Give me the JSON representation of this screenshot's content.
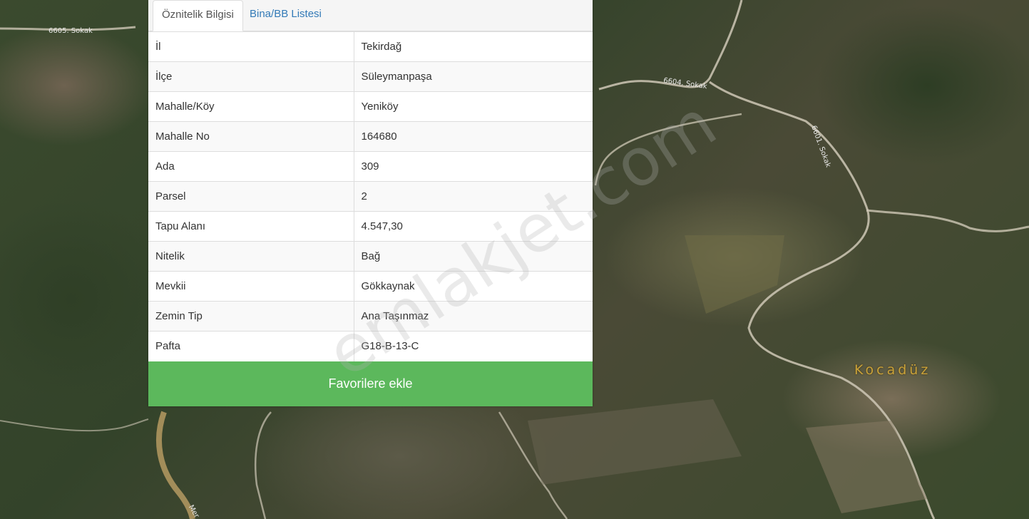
{
  "map": {
    "place_label": "Kocadüz",
    "road_labels": [
      "6605. Sokak",
      "6604. Sokak",
      "6601. Sokak",
      "Mer"
    ]
  },
  "panel": {
    "tabs": [
      {
        "label": "Öznitelik Bilgisi",
        "active": true
      },
      {
        "label": "Bina/BB Listesi",
        "active": false
      }
    ],
    "rows": [
      {
        "key": "İl",
        "value": "Tekirdağ"
      },
      {
        "key": "İlçe",
        "value": "Süleymanpaşa"
      },
      {
        "key": "Mahalle/Köy",
        "value": "Yeniköy"
      },
      {
        "key": "Mahalle No",
        "value": "164680"
      },
      {
        "key": "Ada",
        "value": "309"
      },
      {
        "key": "Parsel",
        "value": "2"
      },
      {
        "key": "Tapu Alanı",
        "value": "4.547,30"
      },
      {
        "key": "Nitelik",
        "value": "Bağ"
      },
      {
        "key": "Mevkii",
        "value": "Gökkaynak"
      },
      {
        "key": "Zemin Tip",
        "value": "Ana Taşınmaz"
      },
      {
        "key": "Pafta",
        "value": "G18-B-13-C"
      }
    ],
    "favorite_button": "Favorilere ekle"
  },
  "watermark": "emlakjet.com",
  "colors": {
    "button_green": "#5cb85c",
    "tab_link": "#337ab7",
    "place_label": "#c9a23a"
  }
}
